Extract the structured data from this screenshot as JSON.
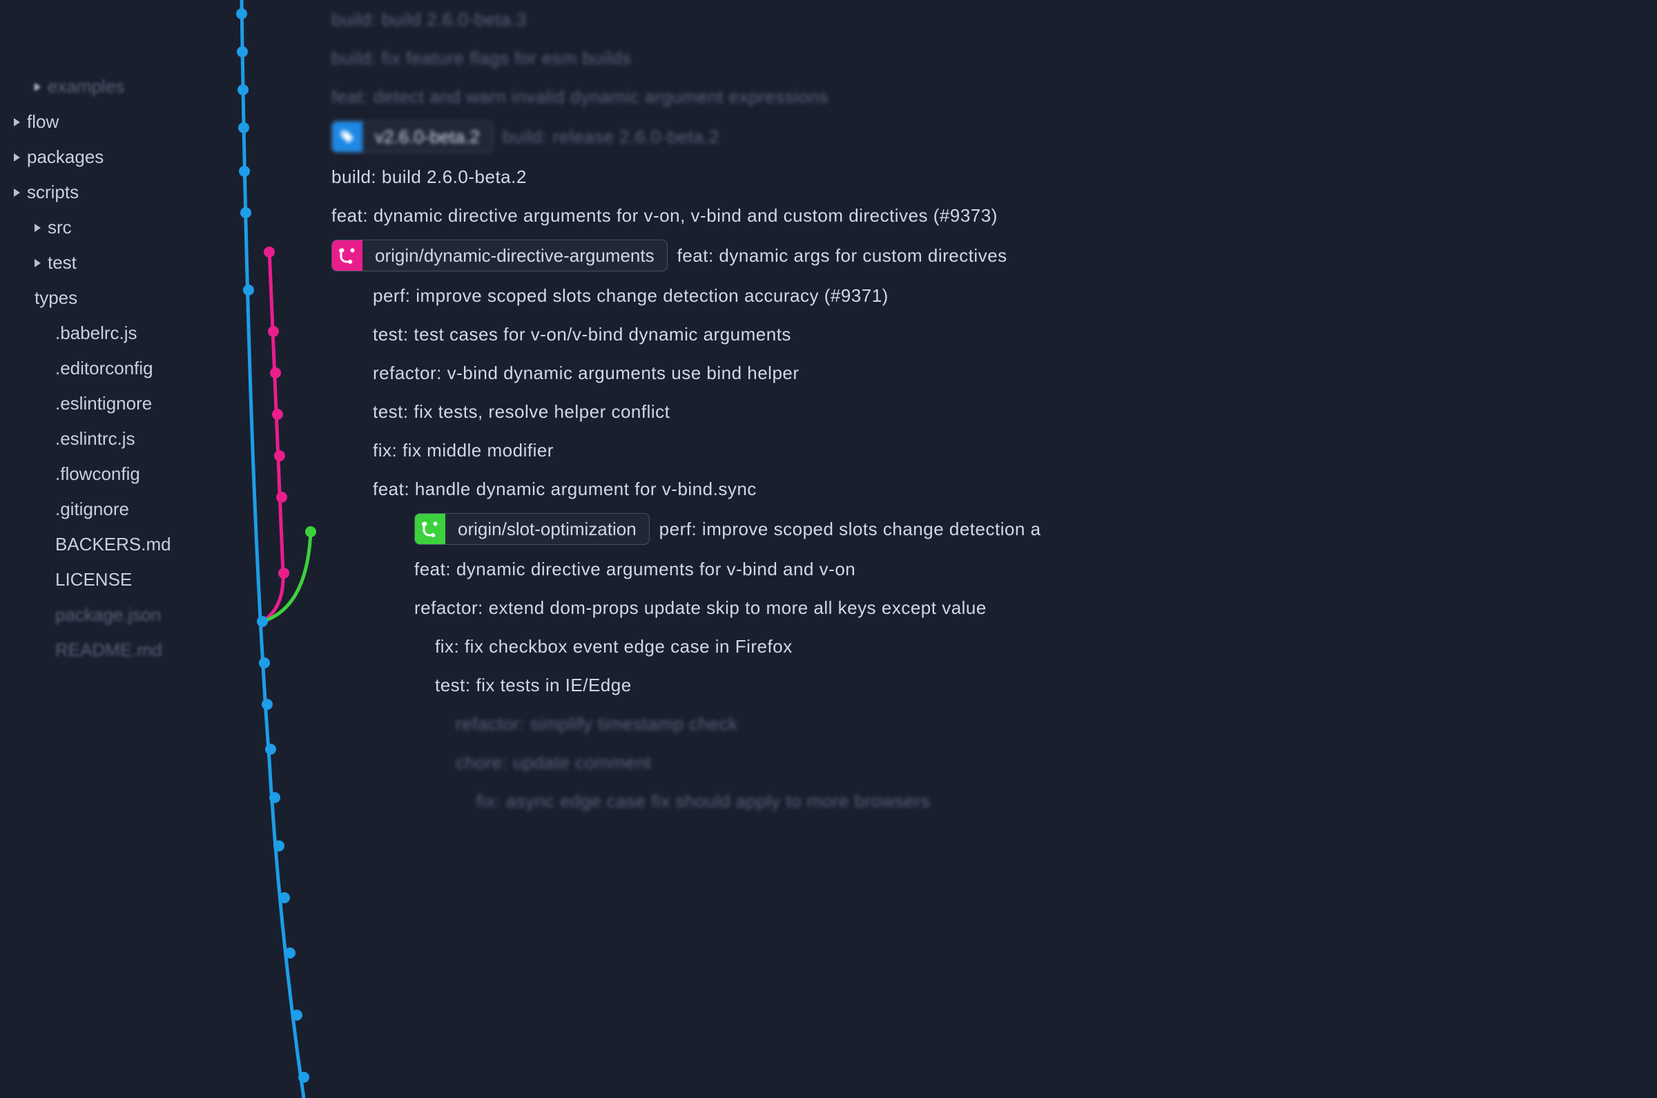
{
  "colors": {
    "blue": "#1e9de8",
    "pink": "#e91e8c",
    "green": "#3dd13d",
    "bg": "#1a1f2e"
  },
  "sidebar": {
    "items": [
      {
        "label": "",
        "dim": true,
        "arrow": false,
        "indent": 0
      },
      {
        "label": "",
        "dim": true,
        "arrow": false,
        "indent": 0
      },
      {
        "label": "",
        "dim": true,
        "arrow": false,
        "indent": 0
      },
      {
        "label": "",
        "dim": true,
        "arrow": false,
        "indent": 1
      },
      {
        "label": "examples",
        "dim": true,
        "arrow": true,
        "indent": 1
      },
      {
        "label": "flow",
        "dim": false,
        "arrow": true,
        "indent": 0
      },
      {
        "label": "packages",
        "dim": false,
        "arrow": true,
        "indent": 0
      },
      {
        "label": "scripts",
        "dim": false,
        "arrow": true,
        "indent": 0
      },
      {
        "label": "src",
        "dim": false,
        "arrow": true,
        "indent": 1
      },
      {
        "label": "test",
        "dim": false,
        "arrow": true,
        "indent": 1
      },
      {
        "label": "types",
        "dim": false,
        "arrow": false,
        "indent": 1
      },
      {
        "label": ".babelrc.js",
        "dim": false,
        "arrow": false,
        "indent": 2
      },
      {
        "label": ".editorconfig",
        "dim": false,
        "arrow": false,
        "indent": 2
      },
      {
        "label": ".eslintignore",
        "dim": false,
        "arrow": false,
        "indent": 2
      },
      {
        "label": ".eslintrc.js",
        "dim": false,
        "arrow": false,
        "indent": 2
      },
      {
        "label": ".flowconfig",
        "dim": false,
        "arrow": false,
        "indent": 2
      },
      {
        "label": ".gitignore",
        "dim": false,
        "arrow": false,
        "indent": 2
      },
      {
        "label": "BACKERS.md",
        "dim": false,
        "arrow": false,
        "indent": 2
      },
      {
        "label": "LICENSE",
        "dim": false,
        "arrow": false,
        "indent": 2
      },
      {
        "label": "package.json",
        "dim": true,
        "arrow": false,
        "indent": 2
      },
      {
        "label": "README.md",
        "dim": true,
        "arrow": false,
        "indent": 2
      }
    ]
  },
  "commits": [
    {
      "msg": "build: build 2.6.0-beta.3",
      "dim": true,
      "offset": 0
    },
    {
      "msg": "build: fix feature flags for esm builds",
      "dim": true,
      "offset": 0
    },
    {
      "msg": "feat: detect and warn invalid dynamic argument expressions",
      "dim": true,
      "offset": 0
    },
    {
      "tag": {
        "color": "blue",
        "icon": "tag",
        "label": "v2.6.0-beta.2"
      },
      "msg": "build: release 2.6.0-beta.2",
      "dim": true,
      "offset": 0
    },
    {
      "msg": "build: build 2.6.0-beta.2",
      "dim": false,
      "offset": 0
    },
    {
      "msg": "feat: dynamic directive arguments for v-on, v-bind and custom directives (#9373)",
      "dim": false,
      "offset": 0
    },
    {
      "tag": {
        "color": "pink",
        "icon": "branch",
        "label": "origin/dynamic-directive-arguments"
      },
      "msg": "feat: dynamic args for custom directives",
      "dim": false,
      "offset": 0
    },
    {
      "msg": "perf: improve scoped slots change detection accuracy (#9371)",
      "dim": false,
      "offset": 1
    },
    {
      "msg": "test: test cases for v-on/v-bind dynamic arguments",
      "dim": false,
      "offset": 1
    },
    {
      "msg": "refactor: v-bind dynamic arguments use bind helper",
      "dim": false,
      "offset": 1
    },
    {
      "msg": "test: fix tests, resolve helper conflict",
      "dim": false,
      "offset": 1
    },
    {
      "msg": "fix: fix middle modifier",
      "dim": false,
      "offset": 1
    },
    {
      "msg": "feat: handle dynamic argument for v-bind.sync",
      "dim": false,
      "offset": 1
    },
    {
      "tag": {
        "color": "green",
        "icon": "branch",
        "label": "origin/slot-optimization"
      },
      "msg": "perf: improve scoped slots change detection a",
      "dim": false,
      "offset": 2
    },
    {
      "msg": "feat: dynamic directive arguments for v-bind and v-on",
      "dim": false,
      "offset": 2
    },
    {
      "msg": "refactor: extend dom-props update skip to more all keys except value",
      "dim": false,
      "offset": 2
    },
    {
      "msg": "fix: fix checkbox event edge case in Firefox",
      "dim": false,
      "offset": 3
    },
    {
      "msg": "test: fix tests in IE/Edge",
      "dim": false,
      "offset": 3
    },
    {
      "msg": "refactor: simplify timestamp check",
      "dim": true,
      "offset": 4
    },
    {
      "msg": "chore: update comment",
      "dim": true,
      "offset": 4
    },
    {
      "msg": "fix: async edge case fix should apply to more browsers",
      "dim": true,
      "offset": 5
    }
  ]
}
